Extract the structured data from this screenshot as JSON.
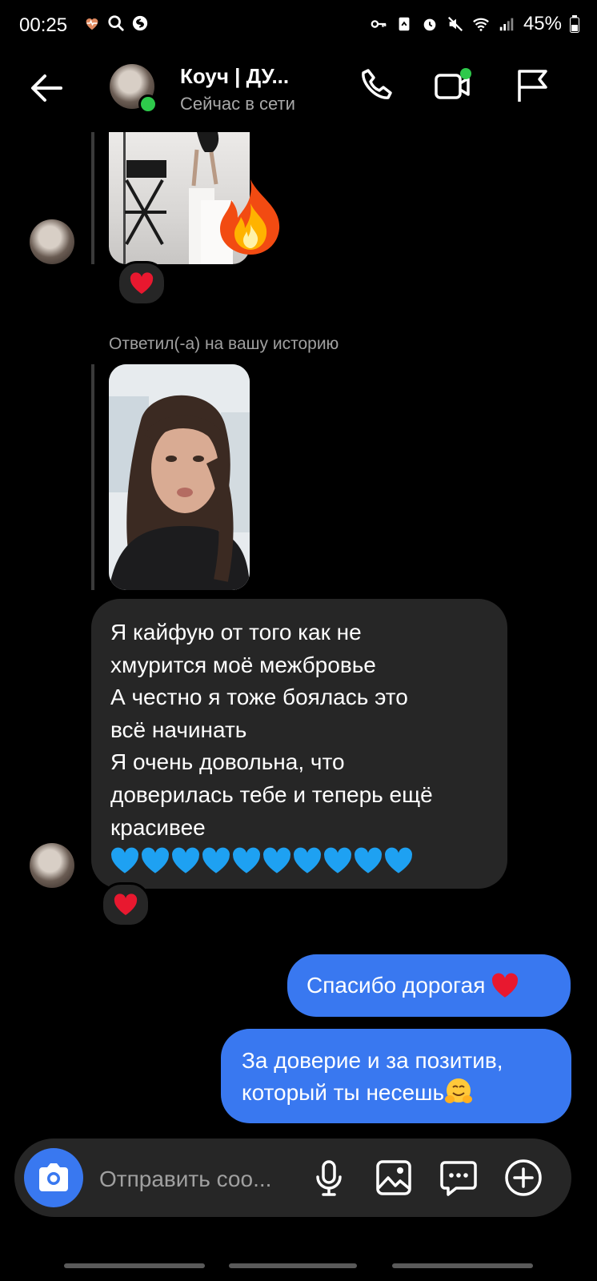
{
  "status_bar": {
    "time": "00:25",
    "battery": "45%"
  },
  "header": {
    "contact_name": "Коуч | ДУ...",
    "contact_status": "Сейчас в сети",
    "online_color": "#2ec94b"
  },
  "thread": {
    "reply_label": "Ответил(-а) на вашу историю",
    "incoming_message": "Я кайфую от того как не\nхмурится моё межбровье\nА честно я тоже боялась это\nвсё начинать\nЯ очень довольна, что\nдоверилась тебе и теперь ещё\nкрасивее",
    "incoming_hearts_count": 10,
    "outgoing_1": "Спасибо дорогая",
    "outgoing_2": "За доверие и за позитив,\nкоторый ты несешь",
    "reactions": [
      "heart",
      "heart"
    ],
    "outgoing_color": "#3978f0"
  },
  "composer": {
    "placeholder": "Отправить соо..."
  },
  "icons": {
    "back": "arrow-left-icon",
    "call": "phone-icon",
    "video": "video-camera-icon",
    "flag": "flag-icon",
    "camera": "camera-icon",
    "mic": "microphone-icon",
    "gallery": "image-icon",
    "sticker": "chat-bubble-icon",
    "plus": "plus-circle-icon"
  }
}
